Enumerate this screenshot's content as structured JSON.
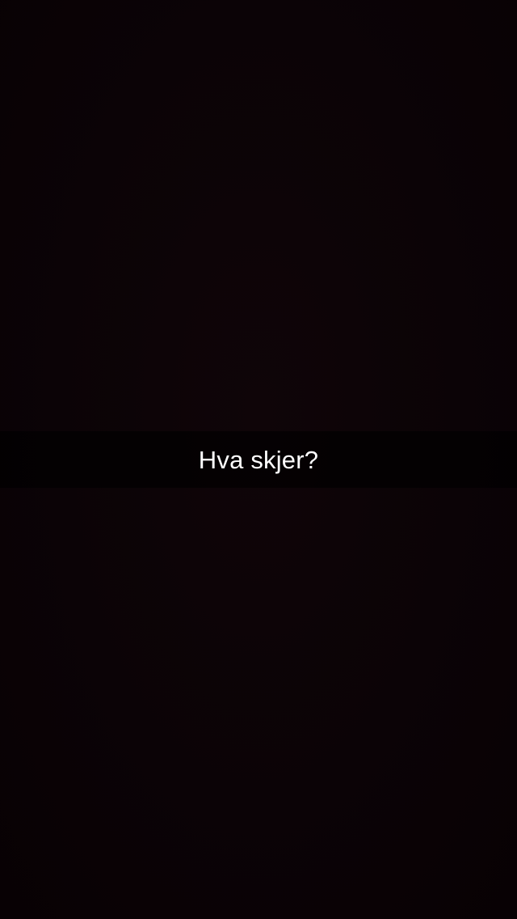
{
  "caption": {
    "text": "Hva skjer?"
  },
  "colors": {
    "background": "#0b0306",
    "caption_bar": "#000000",
    "caption_text": "#ffffff"
  }
}
